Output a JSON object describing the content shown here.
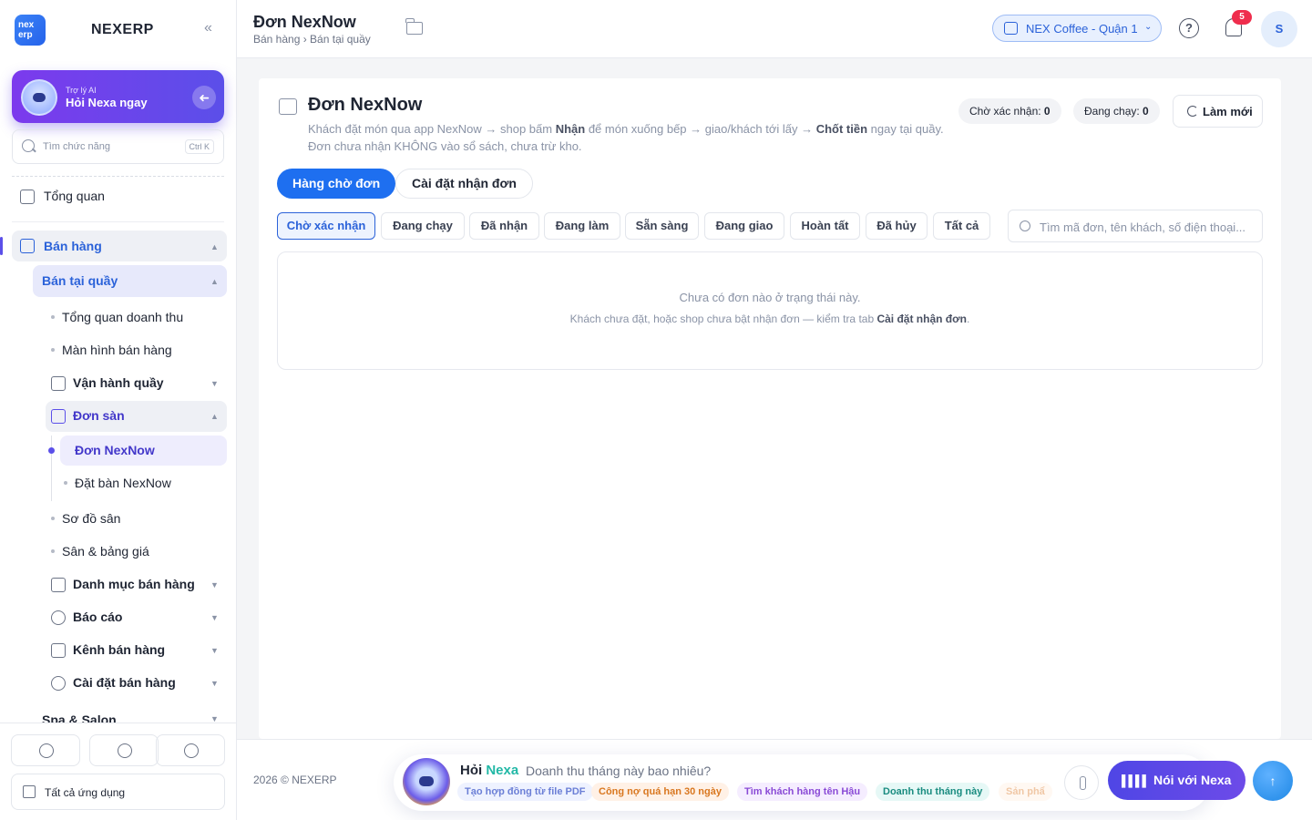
{
  "brand": {
    "logo_text": "nex erp",
    "name": "NEXERP",
    "collapse_icon": "«"
  },
  "ai_card": {
    "subtitle": "Trợ lý AI",
    "title": "Hỏi Nexa ngay",
    "go_icon": "➜"
  },
  "sidebar_search": {
    "placeholder": "Tìm chức năng",
    "shortcut": "Ctrl K"
  },
  "nav": {
    "overview": "Tổng quan",
    "sales": "Bán hàng",
    "counter_sales": "Bán tại quầy",
    "revenue_overview": "Tổng quan doanh thu",
    "sales_screen": "Màn hình bán hàng",
    "counter_ops": "Vận hành quầy",
    "platform_orders": "Đơn sàn",
    "nexnow_orders": "Đơn NexNow",
    "nexnow_tables": "Đặt bàn NexNow",
    "court_map": "Sơ đồ sân",
    "court_prices": "Sân & bảng giá",
    "sales_catalog": "Danh mục bán hàng",
    "reports": "Báo cáo",
    "sales_channels": "Kênh bán hàng",
    "sales_settings": "Cài đặt bán hàng",
    "spa": "Spa & Salon",
    "caret_up": "▲",
    "caret_down": "▼"
  },
  "sidebar_bottom": {
    "all_apps": "Tất cả ứng dụng"
  },
  "header": {
    "title": "Đơn NexNow",
    "breadcrumb": "Bán hàng › Bán tại quầy",
    "store": "NEX Coffee - Quận 1",
    "store_chevron": "⌄",
    "help": "?",
    "notifications": "5",
    "avatar": "S"
  },
  "card": {
    "title": "Đơn NexNow",
    "desc_line1_a": "Khách đặt món qua app NexNow → shop bấm ",
    "desc_line1_b": "Nhận",
    "desc_line1_c": " để món xuống bếp → giao/khách tới lấy → ",
    "desc_line1_d": "Chốt tiền",
    "desc_line1_e": " ngay tại quầy.",
    "desc_line2": "Đơn chưa nhận KHÔNG vào sổ sách, chưa trừ kho.",
    "pending_label": "Chờ xác nhận: ",
    "pending_value": "0",
    "running_label": "Đang chạy: ",
    "running_value": "0",
    "refresh": "Làm mới"
  },
  "main_tabs": {
    "queue": "Hàng chờ đơn",
    "settings": "Cài đặt nhận đơn"
  },
  "filters": [
    "Chờ xác nhận",
    "Đang chạy",
    "Đã nhận",
    "Đang làm",
    "Sẵn sàng",
    "Đang giao",
    "Hoàn tất",
    "Đã hủy",
    "Tất cả"
  ],
  "order_search": {
    "placeholder": "Tìm mã đơn, tên khách, số điện thoại..."
  },
  "empty": {
    "line1": "Chưa có đơn nào ở trạng thái này.",
    "line2_a": "Khách chưa đặt, hoặc shop chưa bật nhận đơn — kiểm tra tab ",
    "line2_b": "Cài đặt nhận đơn",
    "line2_c": "."
  },
  "footer": {
    "copyright": "2026 © NEXERP",
    "nexa_label_1": "Hỏi ",
    "nexa_label_2": "Nexa",
    "prompt": "Doanh thu tháng này bao nhiêu?",
    "chips": [
      "Tạo hợp đồng từ file PDF",
      "Công nợ quá hạn 30 ngày",
      "Tìm khách hàng tên Hậu",
      "Doanh thu tháng này",
      "Sản phẩ"
    ],
    "talk": "Nói với Nexa",
    "talk_icon": "▌▌▌▌",
    "send_icon": "↑"
  },
  "colors": {
    "accent": "#1e6ff0",
    "ai_purple": "#5b4fe9",
    "badge_red": "#ef2d4d"
  }
}
